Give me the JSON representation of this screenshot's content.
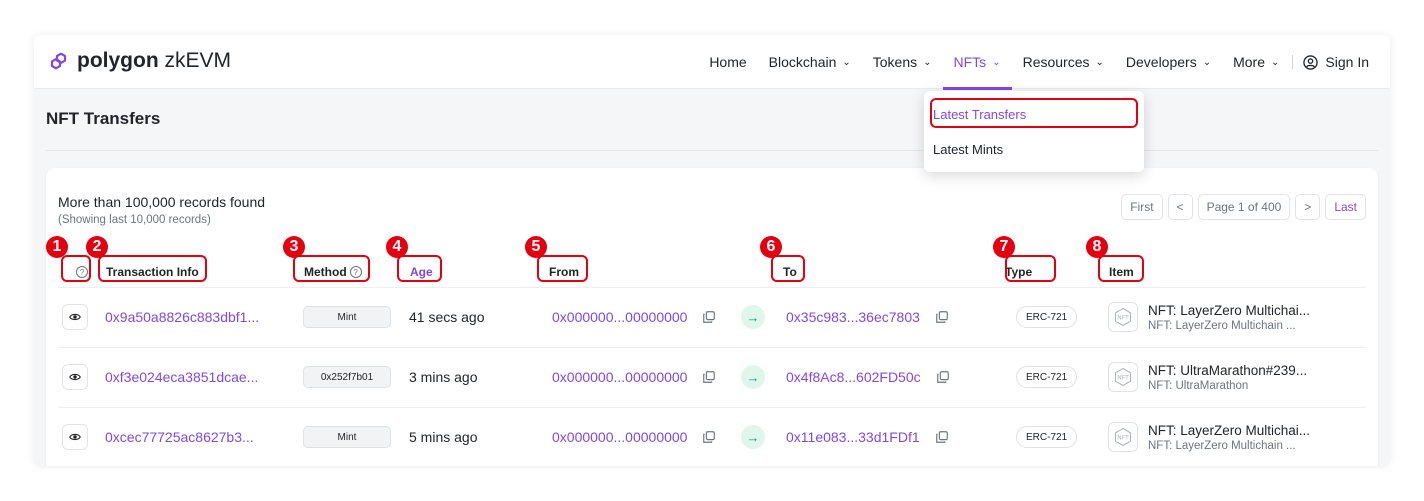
{
  "brand": {
    "name_bold": "polygon",
    "name_rest": " zkEVM"
  },
  "nav": {
    "items": [
      {
        "label": "Home",
        "chevron": false
      },
      {
        "label": "Blockchain",
        "chevron": true
      },
      {
        "label": "Tokens",
        "chevron": true
      },
      {
        "label": "NFTs",
        "chevron": true
      },
      {
        "label": "Resources",
        "chevron": true
      },
      {
        "label": "Developers",
        "chevron": true
      },
      {
        "label": "More",
        "chevron": true
      }
    ],
    "sign_in": "Sign In"
  },
  "dropdown": {
    "items": [
      "Latest Transfers",
      "Latest Mints"
    ]
  },
  "page": {
    "title": "NFT Transfers"
  },
  "records": {
    "count_text": "More than 100,000 records found",
    "sub_text": "(Showing last 10,000 records)"
  },
  "pager": {
    "first": "First",
    "prev": "<",
    "page": "Page 1 of 400",
    "next": ">",
    "last": "Last"
  },
  "table": {
    "headers": {
      "info": "?",
      "txn": "Transaction Info",
      "method": "Method",
      "age": "Age",
      "from": "From",
      "to": "To",
      "type": "Type",
      "item": "Item"
    },
    "rows": [
      {
        "hash": "0x9a50a8826c883dbf1...",
        "method": "Mint",
        "age": "41 secs ago",
        "from": "0x000000...00000000",
        "to": "0x35c983...36ec7803",
        "type": "ERC-721",
        "item_title": "NFT: LayerZero Multichai...",
        "item_sub": "NFT: LayerZero Multichain ..."
      },
      {
        "hash": "0xf3e024eca3851dcae...",
        "method": "0x252f7b01",
        "age": "3 mins ago",
        "from": "0x000000...00000000",
        "to": "0x4f8Ac8...602FD50c",
        "type": "ERC-721",
        "item_title": "NFT: UltraMarathon#239...",
        "item_sub": "NFT: UltraMarathon"
      },
      {
        "hash": "0xcec77725ac8627b3...",
        "method": "Mint",
        "age": "5 mins ago",
        "from": "0x000000...00000000",
        "to": "0x11e083...33d1FDf1",
        "type": "ERC-721",
        "item_title": "NFT: LayerZero Multichai...",
        "item_sub": "NFT: LayerZero Multichain ..."
      }
    ]
  },
  "annotations": [
    "1",
    "2",
    "3",
    "4",
    "5",
    "6",
    "7",
    "8"
  ],
  "colors": {
    "accent": "#8247e5",
    "annotation": "#e3000f",
    "arrow": "#00a186"
  }
}
